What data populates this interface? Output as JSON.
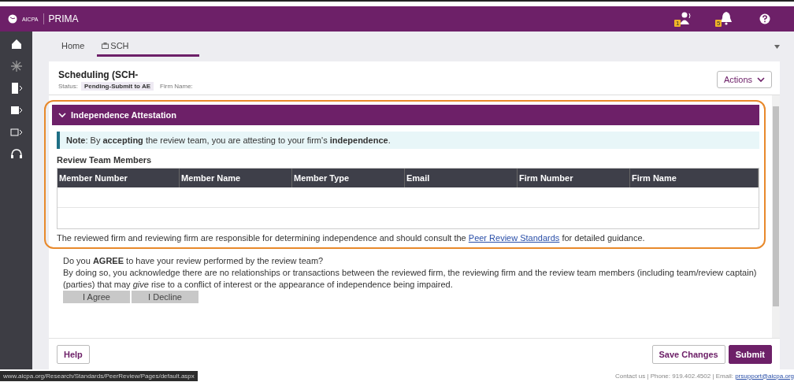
{
  "header": {
    "logo": "AICPA",
    "app_name": "PRIMA",
    "badges": [
      {
        "kind": "contacts",
        "count": "1"
      },
      {
        "kind": "bell",
        "count": "5"
      }
    ]
  },
  "tabs": [
    {
      "label": "Home",
      "selected": false,
      "kind": "plain"
    },
    {
      "label": "SCH",
      "selected": true,
      "kind": "briefcase"
    }
  ],
  "record": {
    "title": "Scheduling (SCH-",
    "status_label": "Status:",
    "status": "Pending-Submit to AE",
    "firm_label": "Firm Name:",
    "actions": "Actions"
  },
  "section": {
    "title": "Independence Attestation",
    "expanded": true,
    "note": "**Note**: By **accepting** the review team, you are attesting to your firm's **independence**.",
    "table_title": "Review Team Members",
    "columns": [
      "Member Number",
      "Member Name",
      "Member Type",
      "Email",
      "Firm Number",
      "Firm Name"
    ],
    "guidance_before": "The reviewed firm and reviewing firm are responsible for determining independence and should consult the ",
    "guidance_link": "Peer Review Standards",
    "guidance_after": " for detailed guidance."
  },
  "agreement": {
    "question": "Do you **AGREE** to have your review performed by the review team?",
    "text": "By doing so, you acknowledge there are no relationships or transactions between the reviewed firm, the reviewing firm and the review team members (including team/review captain) (parties) that may *give* rise to a conflict of interest or the appearance of independence being impaired.",
    "buttons": [
      "I Agree",
      "I Decline"
    ]
  },
  "footer_buttons": [
    {
      "label": "Help",
      "kind": "outline"
    },
    {
      "label": "Save Changes",
      "kind": "outline"
    },
    {
      "label": "Submit",
      "kind": "primary"
    }
  ],
  "status_url": "www.aicpa.org/Research/Standards/PeerReview/Pages/default.aspx",
  "contact": {
    "text": "Contact us | Phone: 919.402.4502 | Email: ",
    "email": "prsupport@aicpa.org"
  }
}
